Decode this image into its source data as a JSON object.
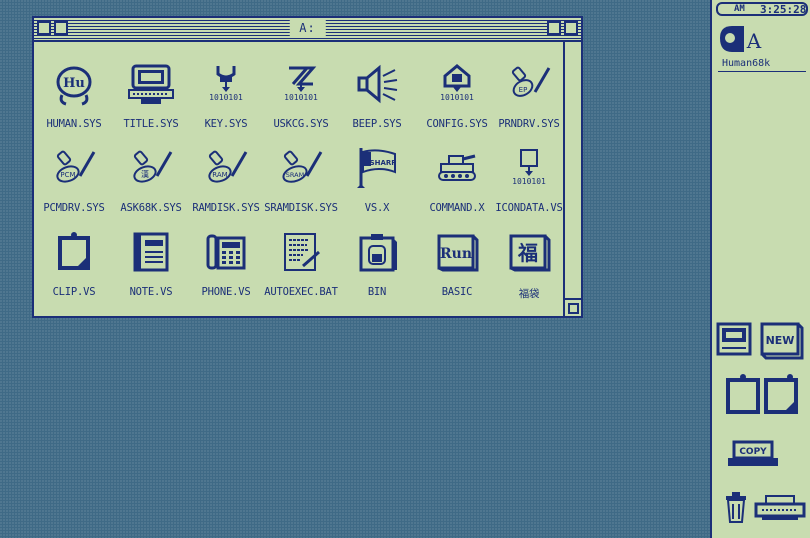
{
  "window": {
    "title": "A:",
    "icons": [
      {
        "label": "HUMAN.SYS",
        "icon": "human-hu-icon"
      },
      {
        "label": "TITLE.SYS",
        "icon": "computer-x68000-icon"
      },
      {
        "label": "KEY.SYS",
        "icon": "keyboard-driver-icon",
        "caption": "1010101"
      },
      {
        "label": "USKCG.SYS",
        "icon": "font-driver-icon",
        "caption": "1010101"
      },
      {
        "label": "BEEP.SYS",
        "icon": "speaker-beep-icon"
      },
      {
        "label": "CONFIG.SYS",
        "icon": "house-config-icon",
        "caption": "1010101"
      },
      {
        "label": "PRNDRV.SYS",
        "icon": "device-pen-icon",
        "caption": "EP"
      },
      {
        "label": "PCMDRV.SYS",
        "icon": "device-pen-icon",
        "caption": "PCM"
      },
      {
        "label": "ASK68K.SYS",
        "icon": "device-pen-icon",
        "caption": "漢"
      },
      {
        "label": "RAMDISK.SYS",
        "icon": "device-pen-icon",
        "caption": "RAM"
      },
      {
        "label": "SRAMDISK.SYS",
        "icon": "device-pen-icon",
        "caption": "SRAM"
      },
      {
        "label": "VS.X",
        "icon": "sharp-flag-icon",
        "caption": "SHARP"
      },
      {
        "label": "COMMAND.X",
        "icon": "tank-command-icon"
      },
      {
        "label": "ICONDATA.VS",
        "icon": "icondata-icon",
        "caption": "1010101"
      },
      {
        "label": "CLIP.VS",
        "icon": "clipboard-note-icon"
      },
      {
        "label": "NOTE.VS",
        "icon": "notebook-icon"
      },
      {
        "label": "PHONE.VS",
        "icon": "telephone-icon"
      },
      {
        "label": "AUTOEXEC.BAT",
        "icon": "batch-document-icon"
      },
      {
        "label": "BIN",
        "icon": "bin-jar-icon"
      },
      {
        "label": "BASIC",
        "icon": "basic-run-icon",
        "caption": "Run"
      },
      {
        "label": "福袋",
        "icon": "fukubukuro-icon",
        "caption": "福"
      }
    ]
  },
  "sidebar": {
    "clock": {
      "ampm": "AM",
      "time": "3:25:28"
    },
    "drive_letter": "A",
    "drive_label": "Human68k",
    "tools": [
      {
        "name": "new-window-icon",
        "label": "NEW"
      },
      {
        "name": "clipboard-pair-icon"
      },
      {
        "name": "copy-machine-icon",
        "label": "COPY"
      },
      {
        "name": "trash-can-icon"
      },
      {
        "name": "printer-icon"
      }
    ]
  },
  "colors": {
    "ink": "#1b2f78",
    "paper": "#c8dcb0",
    "desktop": "#3f6a86"
  }
}
